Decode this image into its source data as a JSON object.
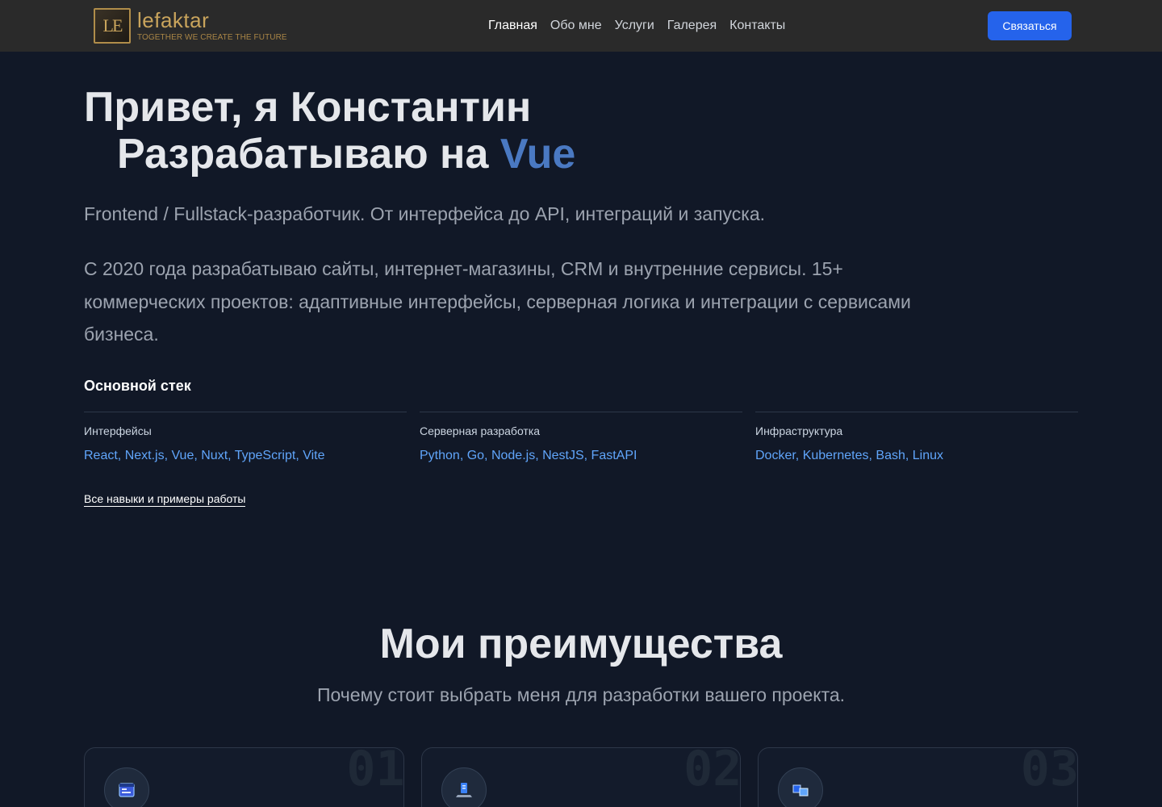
{
  "header": {
    "logo_mark": "LE",
    "logo_name": "lefaktar",
    "logo_tagline": "TOGETHER WE CREATE THE FUTURE",
    "nav": [
      {
        "label": "Главная",
        "active": true
      },
      {
        "label": "Обо мне",
        "active": false
      },
      {
        "label": "Услуги",
        "active": false
      },
      {
        "label": "Галерея",
        "active": false
      },
      {
        "label": "Контакты",
        "active": false
      }
    ],
    "cta_label": "Связаться"
  },
  "hero": {
    "title_line1": "Привет, я Константин",
    "title_line2_prefix": "Разрабатываю на ",
    "title_line2_accent": "Vue",
    "subtitle": "Frontend / Fullstack-разработчик. От интерфейса до API, интеграций и запуска.",
    "description": "С 2020 года разрабатываю сайты, интернет-магазины, CRM и внутренние сервисы. 15+ коммерческих проектов: адаптивные интерфейсы, серверная логика и интеграции с сервисами бизнеса.",
    "stack_title": "Основной стек",
    "stack": [
      {
        "category": "Интерфейсы",
        "items": "React, Next.js, Vue, Nuxt, TypeScript, Vite"
      },
      {
        "category": "Серверная разработка",
        "items": "Python, Go, Node.js, NestJS, FastAPI"
      },
      {
        "category": "Инфраструктура",
        "items": "Docker, Kubernetes, Bash, Linux"
      }
    ],
    "skills_link": "Все навыки и примеры работы"
  },
  "advantages": {
    "title": "Мои преимущества",
    "subtitle": "Почему стоит выбрать меня для разработки вашего проекта.",
    "cards": [
      {
        "number": "01",
        "icon": "browser-window-icon"
      },
      {
        "number": "02",
        "icon": "server-laptop-icon"
      },
      {
        "number": "03",
        "icon": "cubes-icon"
      }
    ]
  },
  "colors": {
    "background": "#111827",
    "header": "#2a2a2a",
    "accent": "#4a79c2",
    "link": "#60a5fa",
    "button": "#2563eb",
    "logo_gold": "#c9a45c"
  }
}
